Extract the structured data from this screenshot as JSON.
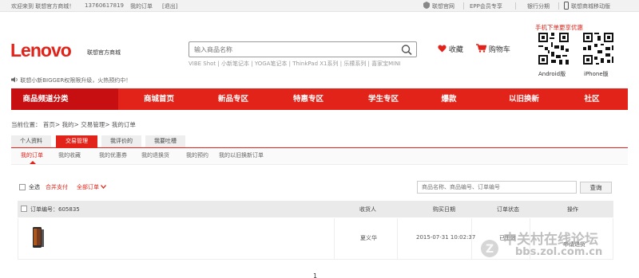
{
  "topbar": {
    "welcome": "欢迎来到 联想官方商城！",
    "phone": "13760617819",
    "my_orders": "我的订单",
    "logout": "[退出]",
    "links": [
      "联想官网",
      "EPP会员专享",
      "银行分期",
      "联想商城移动版"
    ]
  },
  "header": {
    "logo": "Lenovo",
    "logo_sub": "联想官方商城",
    "search_placeholder": "输入商品名称",
    "hotwords": "VIBE Shot | 小新笔记本 | YOGA笔记本 | ThinkPad X1系列 | 乐檬系列 | 喜家宝MINI",
    "favorites": "收藏",
    "cart": "购物车",
    "promo": "手机下单更享优惠",
    "qr_android": "Android版",
    "qr_iphone": "iPhone版",
    "notice": "联想小新BIGGER权限限升级，火热预约中！"
  },
  "nav": {
    "category": "商品频道分类",
    "items": [
      "商城首页",
      "新品专区",
      "特惠专区",
      "学生专区",
      "爆款",
      "以旧换新",
      "社区"
    ]
  },
  "breadcrumb": "当前位置： 首页> 我的> 交易管理> 我的订单",
  "tabs": [
    "个人资料",
    "交易管理",
    "我评价的",
    "我要吐槽"
  ],
  "subtabs": [
    "我的订单",
    "我的收藏",
    "我的优惠券",
    "我的退换货",
    "我的预约",
    "我的以旧换新订单"
  ],
  "filter": {
    "select_all": "全选",
    "merge_pay": "合并支付",
    "all_orders": "全部订单",
    "search_placeholder": "商品名称、商品编号、订单编号",
    "search_button": "查询"
  },
  "table": {
    "order_no": "订单编号：605835",
    "headers": [
      "收货人",
      "购买日期",
      "订单状态",
      "操作"
    ],
    "row": {
      "receiver": "夏义华",
      "date": "2015-07-31 10:02:37",
      "status": "已生效",
      "action": "申请退货"
    }
  },
  "pager": "1",
  "watermark": {
    "line1": "中关村在线论坛",
    "line2": "bbs.zol.com.cn"
  },
  "colors": {
    "brand_red": "#e2231a",
    "nav_dark": "#c70f12"
  }
}
